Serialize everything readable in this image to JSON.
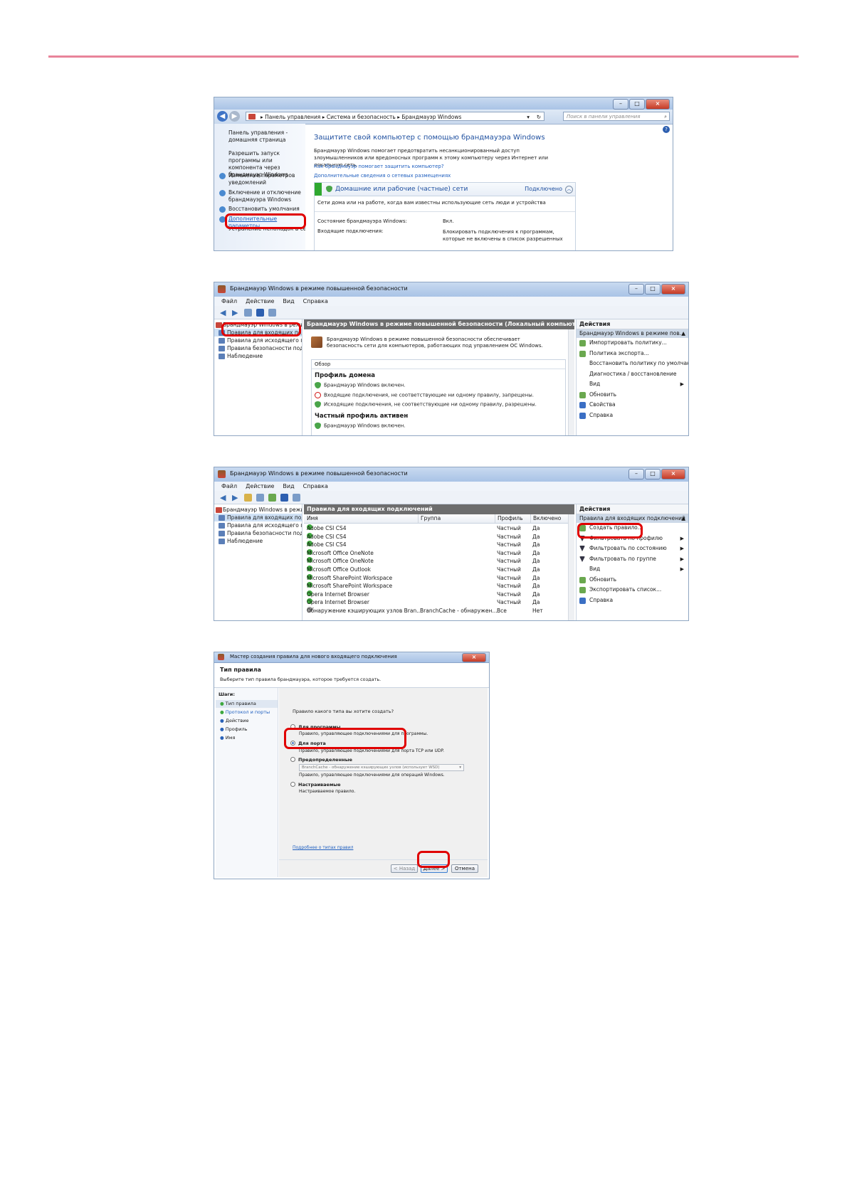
{
  "shot1": {
    "address": [
      "Панель управления",
      "Система и безопасность",
      "Брандмауэр Windows"
    ],
    "search_placeholder": "Поиск в панели управления",
    "left_links": [
      "Панель управления - домашняя страница",
      "Разрешить запуск программы или компонента через брандмауэр Windows",
      "Изменение параметров уведомлений",
      "Включение и отключение брандмауэра Windows",
      "Восстановить умолчания",
      "Дополнительные параметры",
      "Устранение неполадок в сети"
    ],
    "heading": "Защитите свой компьютер с помощью брандмауэра Windows",
    "description": "Брандмауэр Windows помогает предотвратить несанкционированный доступ злоумышленников или вредоносных программ к этому компьютеру через Интернет или локальную сеть.",
    "link_how": "Как брандмауэр помогает защитить компьютер?",
    "link_more": "Дополнительные сведения о сетевых размещениях",
    "network_title": "Домашние или рабочие (частные) сети",
    "network_status": "Подключено",
    "network_desc": "Сети дома или на работе, когда вам известны использующие сеть люди и устройства",
    "state_label": "Состояние брандмауэра Windows:",
    "state_value": "Вкл.",
    "incoming_label": "Входящие подключения:",
    "incoming_value": "Блокировать подключения к программам, которые не включены в список разрешенных"
  },
  "shot2": {
    "title": "Брандмауэр Windows в режиме повышенной безопасности",
    "menu": [
      "Файл",
      "Действие",
      "Вид",
      "Справка"
    ],
    "tree": [
      "Брандмауэр Windows в режиме пов",
      "Правила для входящих подключений",
      "Правила для исходящего подключения",
      "Правила безопасности подключения",
      "Наблюдение"
    ],
    "center_header": "Брандмауэр Windows в режиме повышенной безопасности (Локальный компьютер)",
    "intro": "Брандмауэр Windows в режиме повышенной безопасности обеспечивает безопасность сети для компьютеров, работающих под управлением ОС Windows.",
    "overview_label": "Обзор",
    "domain_profile": "Профиль домена",
    "domain_lines": [
      "Брандмауэр Windows включен.",
      "Входящие подключения, не соответствующие ни одному правилу, запрещены.",
      "Исходящие подключения, не соответствующие ни одному правилу, разрешены."
    ],
    "private_profile": "Частный профиль активен",
    "private_line": "Брандмауэр Windows включен.",
    "actions_header": "Действия",
    "actions_sub": "Брандмауэр Windows в режиме пов...",
    "actions": [
      "Импортировать политику...",
      "Политика экспорта...",
      "Восстановить политику по умолчанию",
      "Диагностика / восстановление",
      "Вид",
      "Обновить",
      "Свойства",
      "Справка"
    ]
  },
  "shot3": {
    "title": "Брандмауэр Windows в режиме повышенной безопасности",
    "menu": [
      "Файл",
      "Действие",
      "Вид",
      "Справка"
    ],
    "tree": [
      "Брандмауэр Windows в режиме пов",
      "Правила для входящих подключений",
      "Правила для исходящего подключения",
      "Правила безопасности подключения",
      "Наблюдение"
    ],
    "center_header": "Правила для входящих подключений",
    "columns": [
      "Имя",
      "Группа",
      "Профиль",
      "Включено"
    ],
    "rows": [
      {
        "name": "Adobe CSI CS4",
        "group": "",
        "profile": "Частный",
        "enabled": "Да"
      },
      {
        "name": "Adobe CSI CS4",
        "group": "",
        "profile": "Частный",
        "enabled": "Да"
      },
      {
        "name": "Adobe CSI CS4",
        "group": "",
        "profile": "Частный",
        "enabled": "Да"
      },
      {
        "name": "Microsoft Office OneNote",
        "group": "",
        "profile": "Частный",
        "enabled": "Да"
      },
      {
        "name": "Microsoft Office OneNote",
        "group": "",
        "profile": "Частный",
        "enabled": "Да"
      },
      {
        "name": "Microsoft Office Outlook",
        "group": "",
        "profile": "Частный",
        "enabled": "Да"
      },
      {
        "name": "Microsoft SharePoint Workspace",
        "group": "",
        "profile": "Частный",
        "enabled": "Да"
      },
      {
        "name": "Microsoft SharePoint Workspace",
        "group": "",
        "profile": "Частный",
        "enabled": "Да"
      },
      {
        "name": "Opera Internet Browser",
        "group": "",
        "profile": "Частный",
        "enabled": "Да"
      },
      {
        "name": "Opera Internet Browser",
        "group": "",
        "profile": "Частный",
        "enabled": "Да"
      },
      {
        "name": "Обнаружение кэширующих узлов Bran...",
        "group": "BranchCache - обнаружен...",
        "profile": "Все",
        "enabled": "Нет"
      }
    ],
    "actions_header": "Действия",
    "actions_sub": "Правила для входящих подключений",
    "actions": [
      "Создать правило...",
      "Фильтровать по профилю",
      "Фильтровать по состоянию",
      "Фильтровать по группе",
      "Вид",
      "Обновить",
      "Экспортировать список...",
      "Справка"
    ]
  },
  "shot4": {
    "title": "Мастер создания правила для нового входящего подключения",
    "heading": "Тип правила",
    "subheading": "Выберите тип правила брандмауэра, которое требуется создать.",
    "steps_label": "Шаги:",
    "steps": [
      "Тип правила",
      "Протокол и порты",
      "Действие",
      "Профиль",
      "Имя"
    ],
    "question": "Правило какого типа вы хотите создать?",
    "options": [
      {
        "label": "Для программы",
        "desc": "Правило, управляющее подключениями для программы."
      },
      {
        "label": "Для порта",
        "desc": "Правило, управляющее подключениями для порта TCP или UDP."
      },
      {
        "label": "Предопределенные",
        "desc": "Правило, управляющее подключениями для операций Windows."
      },
      {
        "label": "Настраиваемые",
        "desc": "Настраиваемое правило."
      }
    ],
    "predefined_select": "BranchCache - обнаружение кэширующих узлов (использует WSD)",
    "learn_link": "Подробнее о типах правил",
    "back_button": "< Назад",
    "next_button": "Далее >",
    "cancel_button": "Отмена"
  }
}
